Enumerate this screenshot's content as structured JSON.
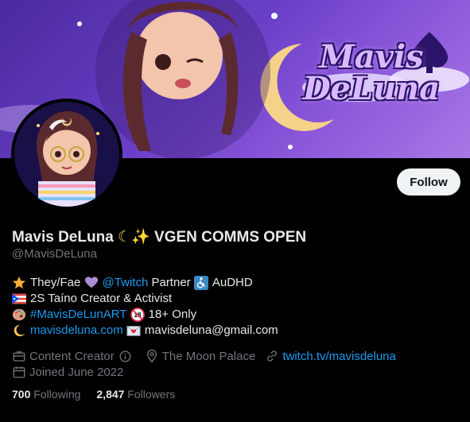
{
  "banner": {
    "title_line1": "Mavis",
    "title_line2": "DeLuna"
  },
  "profile": {
    "display_name": "Mavis DeLuna",
    "display_name_suffix": "VGEN COMMS OPEN",
    "handle": "@MavisDeLuna",
    "follow_label": "Follow"
  },
  "bio": {
    "line1": {
      "text_a": "They/Fae",
      "link": "@Twitch",
      "text_b": "Partner",
      "text_c": "AuDHD"
    },
    "line2": {
      "text": "2S Taíno Creator & Activist"
    },
    "line3": {
      "link": "#MavisDeLunART",
      "text": "18+ Only"
    },
    "line4": {
      "link": "mavisdeluna.com",
      "text": "mavisdeluna@gmail.com"
    }
  },
  "meta": {
    "category": "Content Creator",
    "location": "The Moon Palace",
    "website": "twitch.tv/mavisdeluna",
    "joined": "Joined June 2022"
  },
  "stats": {
    "following_count": "700",
    "following_label": "Following",
    "followers_count": "2,847",
    "followers_label": "Followers"
  },
  "colors": {
    "accent": "#1d9bf0",
    "muted": "#71767b",
    "text": "#e7e9ea",
    "background": "#000000"
  }
}
